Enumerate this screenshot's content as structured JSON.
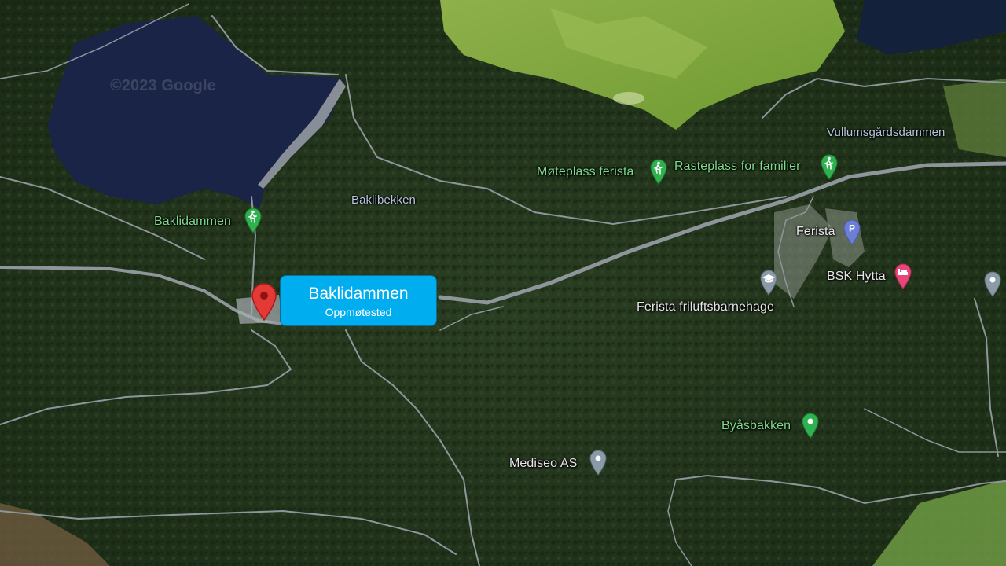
{
  "map": {
    "attribution_watermark": "©2023 Google",
    "labels": {
      "vullumsgardsdammen": "Vullumsgårdsdammen",
      "moteplass": "Møteplass ferista",
      "rasteplass": "Rasteplass for familier",
      "baklibekken": "Baklibekken",
      "baklidammen": "Baklidammen",
      "ferista": "Ferista",
      "bsk_hytta": "BSK Hytta",
      "barnehage": "Ferista friluftsbarnehage",
      "byasbakken": "Byåsbakken",
      "mediseo": "Mediseo AS"
    },
    "icons": {
      "hiking": "hiking-icon",
      "parking": "parking-icon",
      "hotel": "hotel-icon",
      "school": "school-icon",
      "place": "place-pin-icon"
    },
    "colors": {
      "callout": "#00adef",
      "red_pin": "#e53935",
      "green_pin": "#2fb14f",
      "parking_pin": "#6b7fd7",
      "hotel_pin": "#e8457a",
      "grey_pin": "#8a9aa6"
    }
  },
  "callout": {
    "title": "Baklidammen",
    "subtitle": "Oppmøtested"
  }
}
